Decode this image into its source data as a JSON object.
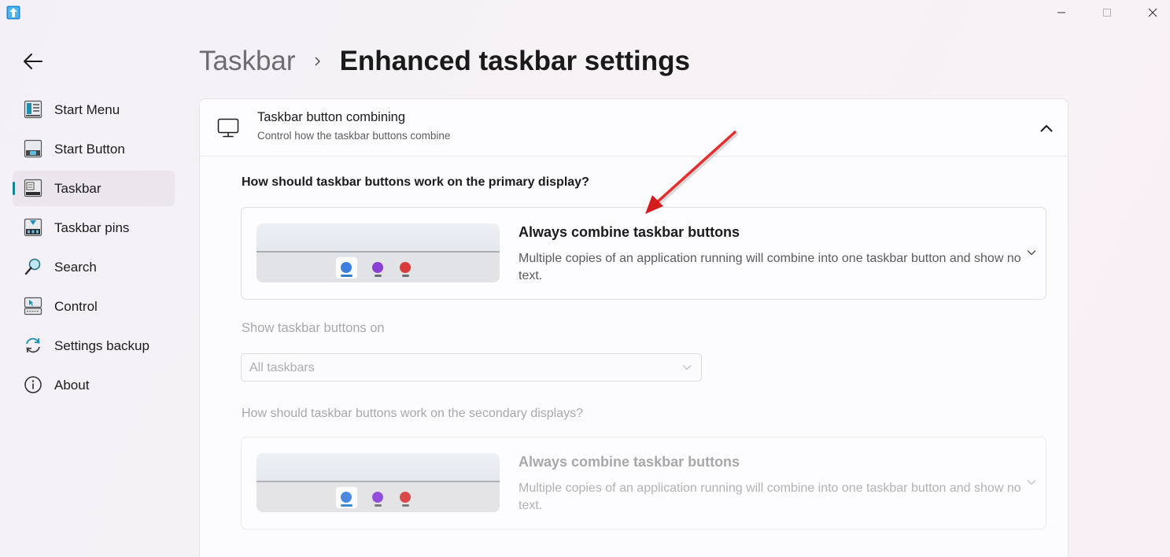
{
  "window": {
    "app_icon": "arrow-up-app-icon",
    "controls": [
      "minimize-icon",
      "maximize-icon",
      "close-icon"
    ]
  },
  "sidebar": {
    "back_icon": "back-arrow-icon",
    "items": [
      {
        "label": "Start Menu",
        "icon": "start-menu-icon",
        "active": false
      },
      {
        "label": "Start Button",
        "icon": "start-button-icon",
        "active": false
      },
      {
        "label": "Taskbar",
        "icon": "taskbar-icon",
        "active": true
      },
      {
        "label": "Taskbar pins",
        "icon": "taskbar-pins-icon",
        "active": false
      },
      {
        "label": "Search",
        "icon": "search-icon",
        "active": false
      },
      {
        "label": "Control",
        "icon": "control-icon",
        "active": false
      },
      {
        "label": "Settings backup",
        "icon": "settings-backup-icon",
        "active": false
      },
      {
        "label": "About",
        "icon": "info-icon",
        "active": false
      }
    ]
  },
  "header": {
    "parent": "Taskbar",
    "separator_icon": "chevron-right-icon",
    "current": "Enhanced taskbar settings"
  },
  "card": {
    "title": "Taskbar button combining",
    "subtitle": "Control how the taskbar buttons combine",
    "icon": "monitor-icon",
    "collapse_icon": "chevron-up-icon",
    "primary": {
      "question": "How should taskbar buttons work on the primary display?",
      "option_title": "Always combine taskbar buttons",
      "option_desc": "Multiple copies of an application running will combine into one taskbar button and show no text."
    },
    "show_on": {
      "label": "Show taskbar buttons on",
      "value": "All taskbars"
    },
    "secondary": {
      "question": "How should taskbar buttons work on the secondary displays?",
      "option_title": "Always combine taskbar buttons",
      "option_desc": "Multiple copies of an application running will combine into one taskbar button and show no text."
    }
  },
  "colors": {
    "accent": "#1a7f99",
    "annotation_arrow": "#e02020",
    "dot_blue": "#3f7fdc",
    "dot_purple": "#8a3fd6",
    "dot_red": "#d63a3a"
  }
}
